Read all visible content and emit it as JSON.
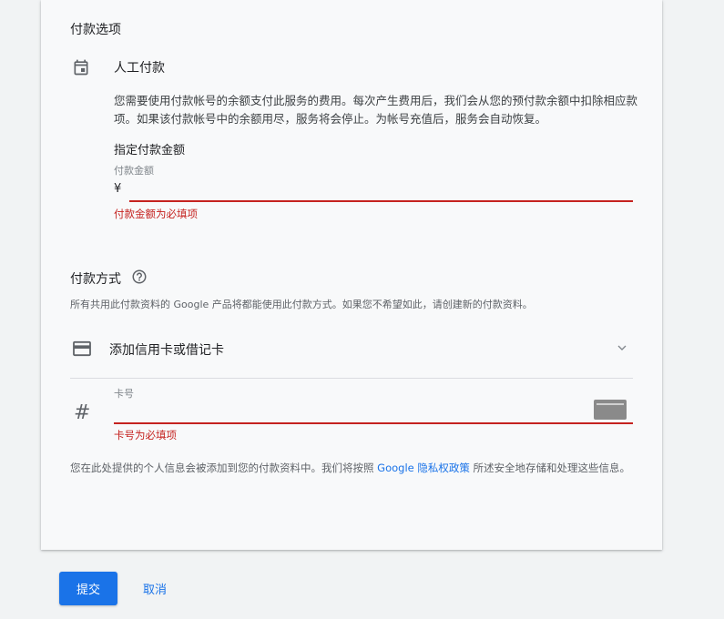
{
  "payment_options": {
    "section_title": "付款选项",
    "manual_title": "人工付款",
    "description": "您需要使用付款帐号的余额支付此服务的费用。每次产生费用后，我们会从您的预付款余额中扣除相应款项。如果该付款帐号中的余额用尽，服务将会停止。为帐号充值后，服务会自动恢复。",
    "amount_title": "指定付款金额",
    "amount_label": "付款金额",
    "currency_symbol": "¥",
    "amount_value": "",
    "amount_error": "付款金额为必填项"
  },
  "payment_method": {
    "title": "付款方式",
    "description": "所有共用此付款资料的 Google 产品将都能使用此付款方式。如果您不希望如此，请创建新的付款资料。",
    "add_card_label": "添加信用卡或借记卡",
    "card_number_label": "卡号",
    "card_number_value": "",
    "card_number_error": "卡号为必填项",
    "privacy_prefix": "您在此处提供的个人信息会被添加到您的付款资料中。我们将按照 ",
    "privacy_link": "Google 隐私权政策",
    "privacy_suffix": " 所述安全地存储和处理这些信息。"
  },
  "actions": {
    "submit_label": "提交",
    "cancel_label": "取消"
  },
  "icons": {
    "calendar": "calendar-icon",
    "help": "help-circle-icon",
    "credit_card": "credit-card-icon",
    "chevron": "chevron-down-icon",
    "hash": "hash-icon",
    "generic_card": "generic-card-icon"
  },
  "colors": {
    "accent": "#1a73e8",
    "error": "#c5221f"
  }
}
